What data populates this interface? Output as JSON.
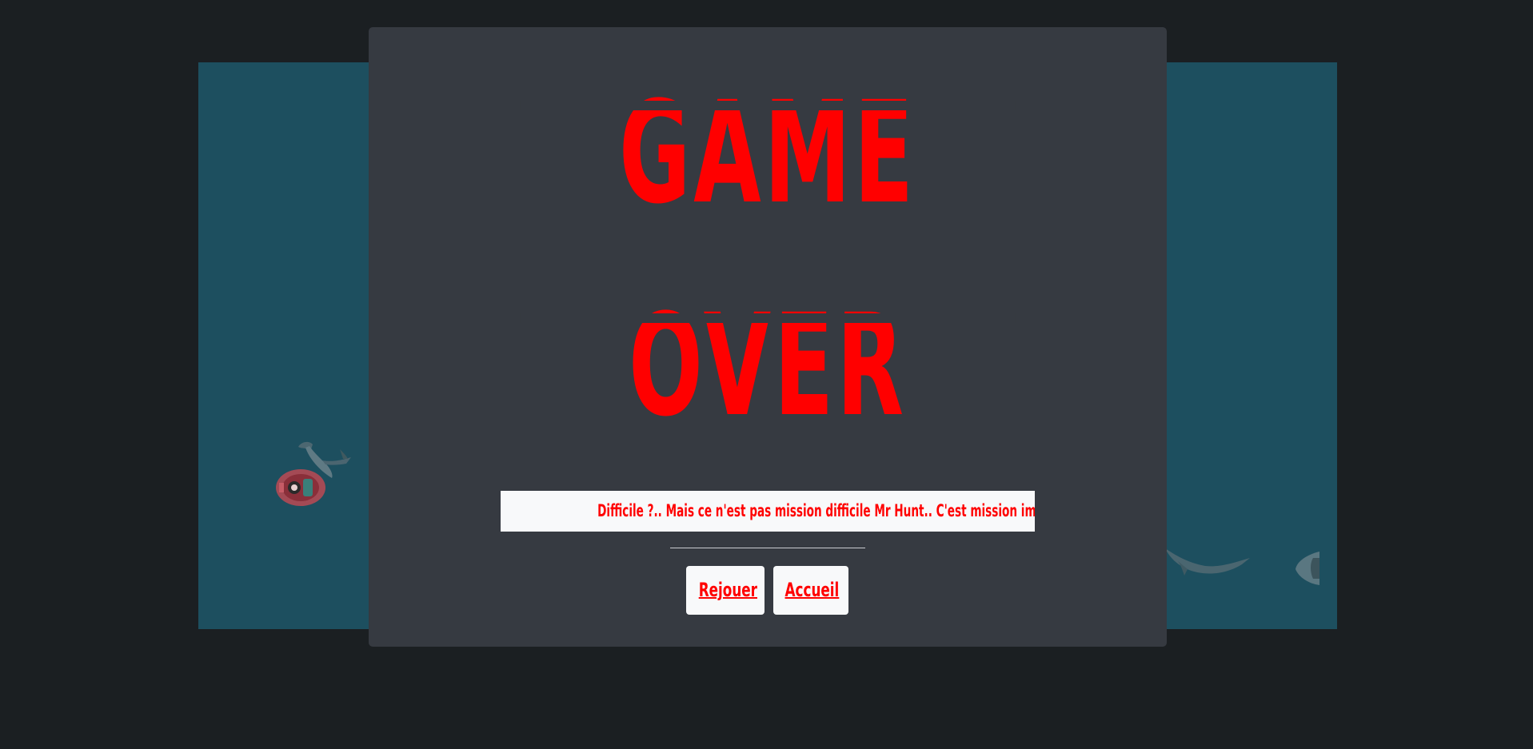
{
  "modal": {
    "title_line1": "GAME",
    "title_line2": "OVER",
    "message": "Difficile ?.. Mais ce n'est pas mission difficile Mr Hunt.. C'est mission impossible !",
    "buttons": {
      "replay": "Rejouer",
      "home": "Accueil"
    }
  },
  "colors": {
    "page_background": "#1b1f22",
    "water": "#1d4f5f",
    "modal_background": "#363a41",
    "accent_red": "#ff0000",
    "button_background": "#f8f9fa"
  },
  "icons": [
    "player-boat-icon",
    "hammerhead-shark-icon",
    "shark-icon"
  ]
}
